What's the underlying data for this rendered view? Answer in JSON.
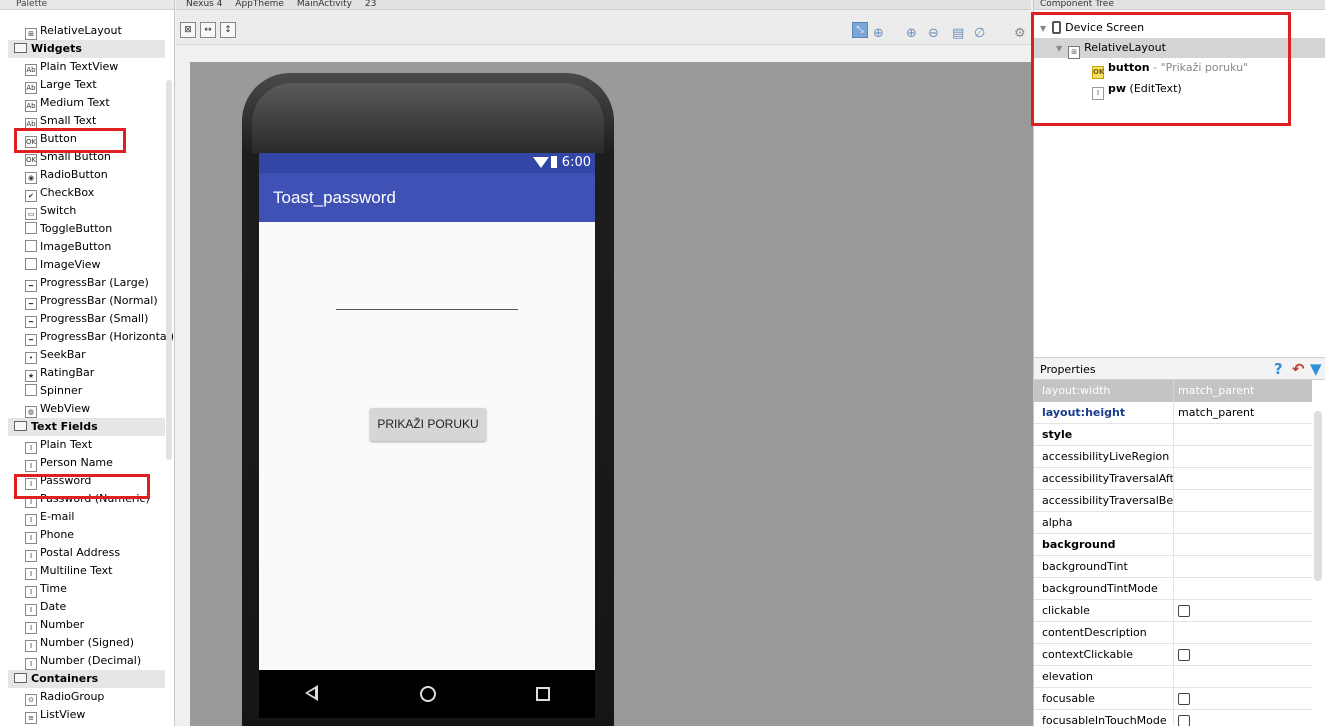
{
  "palette": {
    "header": "Palette",
    "items": [
      {
        "type": "item",
        "label": "RelativeLayout",
        "icon": "relative-layout-icon"
      },
      {
        "type": "category",
        "label": "Widgets"
      },
      {
        "type": "item",
        "label": "Plain TextView",
        "icon": "textview-icon"
      },
      {
        "type": "item",
        "label": "Large Text",
        "icon": "textview-icon"
      },
      {
        "type": "item",
        "label": "Medium Text",
        "icon": "textview-icon"
      },
      {
        "type": "item",
        "label": "Small Text",
        "icon": "textview-icon"
      },
      {
        "type": "item",
        "label": "Button",
        "icon": "button-icon"
      },
      {
        "type": "item",
        "label": "Small Button",
        "icon": "button-icon"
      },
      {
        "type": "item",
        "label": "RadioButton",
        "icon": "radio-icon"
      },
      {
        "type": "item",
        "label": "CheckBox",
        "icon": "checkbox-icon"
      },
      {
        "type": "item",
        "label": "Switch",
        "icon": "switch-icon"
      },
      {
        "type": "item",
        "label": "ToggleButton",
        "icon": "toggle-icon"
      },
      {
        "type": "item",
        "label": "ImageButton",
        "icon": "image-button-icon"
      },
      {
        "type": "item",
        "label": "ImageView",
        "icon": "image-view-icon"
      },
      {
        "type": "item",
        "label": "ProgressBar (Large)",
        "icon": "progress-icon"
      },
      {
        "type": "item",
        "label": "ProgressBar (Normal)",
        "icon": "progress-icon"
      },
      {
        "type": "item",
        "label": "ProgressBar (Small)",
        "icon": "progress-icon"
      },
      {
        "type": "item",
        "label": "ProgressBar (Horizontal)",
        "icon": "progress-icon"
      },
      {
        "type": "item",
        "label": "SeekBar",
        "icon": "seekbar-icon"
      },
      {
        "type": "item",
        "label": "RatingBar",
        "icon": "star-icon"
      },
      {
        "type": "item",
        "label": "Spinner",
        "icon": "spinner-icon"
      },
      {
        "type": "item",
        "label": "WebView",
        "icon": "webview-icon"
      },
      {
        "type": "category",
        "label": "Text Fields"
      },
      {
        "type": "item",
        "label": "Plain Text",
        "icon": "edittext-icon"
      },
      {
        "type": "item",
        "label": "Person Name",
        "icon": "edittext-icon"
      },
      {
        "type": "item",
        "label": "Password",
        "icon": "edittext-icon"
      },
      {
        "type": "item",
        "label": "Password (Numeric)",
        "icon": "edittext-icon"
      },
      {
        "type": "item",
        "label": "E-mail",
        "icon": "edittext-icon"
      },
      {
        "type": "item",
        "label": "Phone",
        "icon": "edittext-icon"
      },
      {
        "type": "item",
        "label": "Postal Address",
        "icon": "edittext-icon"
      },
      {
        "type": "item",
        "label": "Multiline Text",
        "icon": "edittext-icon"
      },
      {
        "type": "item",
        "label": "Time",
        "icon": "edittext-icon"
      },
      {
        "type": "item",
        "label": "Date",
        "icon": "edittext-icon"
      },
      {
        "type": "item",
        "label": "Number",
        "icon": "edittext-icon"
      },
      {
        "type": "item",
        "label": "Number (Signed)",
        "icon": "edittext-icon"
      },
      {
        "type": "item",
        "label": "Number (Decimal)",
        "icon": "edittext-icon"
      },
      {
        "type": "category",
        "label": "Containers"
      },
      {
        "type": "item",
        "label": "RadioGroup",
        "icon": "radiogroup-icon"
      },
      {
        "type": "item",
        "label": "ListView",
        "icon": "listview-icon"
      }
    ]
  },
  "toolbar": {
    "device": "Nexus 4",
    "theme": "AppTheme",
    "activity": "MainActivity",
    "api": "23"
  },
  "phone": {
    "time": "6:00",
    "app_title": "Toast_password",
    "button_label": "PRIKAŽI PORUKU"
  },
  "tree": {
    "header": "Component Tree",
    "root": "Device Screen",
    "layout": "RelativeLayout",
    "button_id": "button",
    "button_text": " - \"Prikaži poruku\"",
    "edit_id": "pw",
    "edit_type": " (EditText)"
  },
  "properties": {
    "title": "Properties",
    "rows": [
      {
        "name": "layout:width",
        "value": "match_parent",
        "style": "highlight"
      },
      {
        "name": "layout:height",
        "value": "match_parent",
        "style": "blue"
      },
      {
        "name": "style",
        "value": "",
        "style": "bold"
      },
      {
        "name": "accessibilityLiveRegion",
        "value": "",
        "style": ""
      },
      {
        "name": "accessibilityTraversalAfter",
        "value": "",
        "style": ""
      },
      {
        "name": "accessibilityTraversalBefore",
        "value": "",
        "style": ""
      },
      {
        "name": "alpha",
        "value": "",
        "style": ""
      },
      {
        "name": "background",
        "value": "",
        "style": "bold"
      },
      {
        "name": "backgroundTint",
        "value": "",
        "style": ""
      },
      {
        "name": "backgroundTintMode",
        "value": "",
        "style": ""
      },
      {
        "name": "clickable",
        "value": "checkbox",
        "style": ""
      },
      {
        "name": "contentDescription",
        "value": "",
        "style": ""
      },
      {
        "name": "contextClickable",
        "value": "checkbox",
        "style": ""
      },
      {
        "name": "elevation",
        "value": "",
        "style": ""
      },
      {
        "name": "focusable",
        "value": "checkbox",
        "style": ""
      },
      {
        "name": "focusableInTouchMode",
        "value": "checkbox",
        "style": ""
      }
    ]
  },
  "colors": {
    "app_bar": "#3f51b5",
    "status_bar": "#3146a5",
    "annotation": "#e02020"
  }
}
